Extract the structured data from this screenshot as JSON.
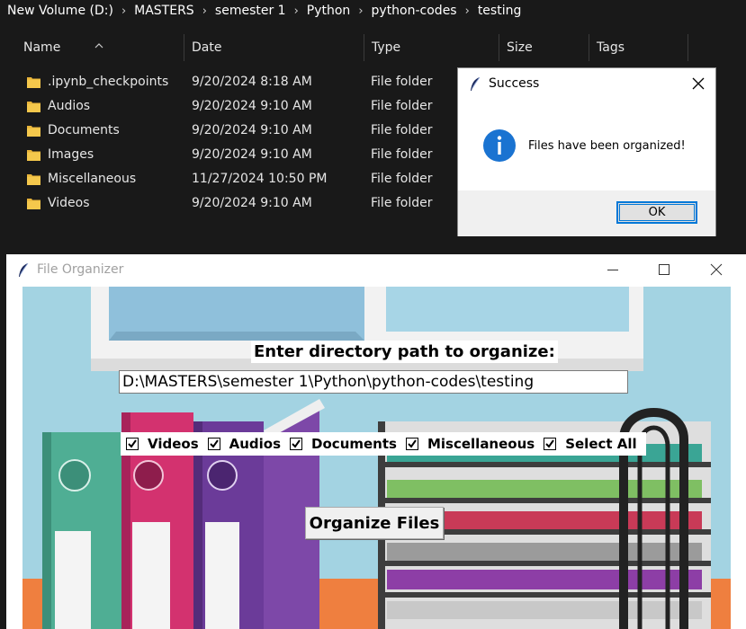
{
  "breadcrumb": [
    "New Volume (D:)",
    "MASTERS",
    "semester 1",
    "Python",
    "python-codes",
    "testing"
  ],
  "columns": {
    "name": "Name",
    "date": "Date",
    "type": "Type",
    "size": "Size",
    "tags": "Tags"
  },
  "files": [
    {
      "name": ".ipynb_checkpoints",
      "date": "9/20/2024 8:18 AM",
      "type": "File folder"
    },
    {
      "name": "Audios",
      "date": "9/20/2024 9:10 AM",
      "type": "File folder"
    },
    {
      "name": "Documents",
      "date": "9/20/2024 9:10 AM",
      "type": "File folder"
    },
    {
      "name": "Images",
      "date": "9/20/2024 9:10 AM",
      "type": "File folder"
    },
    {
      "name": "Miscellaneous",
      "date": "11/27/2024 10:50 PM",
      "type": "File folder"
    },
    {
      "name": "Videos",
      "date": "9/20/2024 9:10 AM",
      "type": "File folder"
    }
  ],
  "dialog": {
    "title": "Success",
    "message": "Files have been organized!",
    "ok": "OK"
  },
  "app": {
    "title": "File Organizer",
    "prompt": "Enter directory path to organize:",
    "path_value": "D:\\MASTERS\\semester 1\\Python\\python-codes\\testing",
    "checkboxes": [
      {
        "label": "Videos",
        "checked": true
      },
      {
        "label": "Audios",
        "checked": true
      },
      {
        "label": "Documents",
        "checked": true
      },
      {
        "label": "Miscellaneous",
        "checked": true
      },
      {
        "label": "Select All",
        "checked": true
      }
    ],
    "button": "Organize Files"
  },
  "icons": {
    "folder": "folder-icon",
    "info": "info-icon",
    "feather": "tk-feather-icon",
    "close": "close-icon",
    "minimize": "minimize-icon",
    "maximize": "maximize-icon"
  },
  "colors": {
    "folder": "#e8b339",
    "info_blue": "#1a73d1",
    "accent": "#0078d7",
    "explorer_bg": "#191919"
  }
}
